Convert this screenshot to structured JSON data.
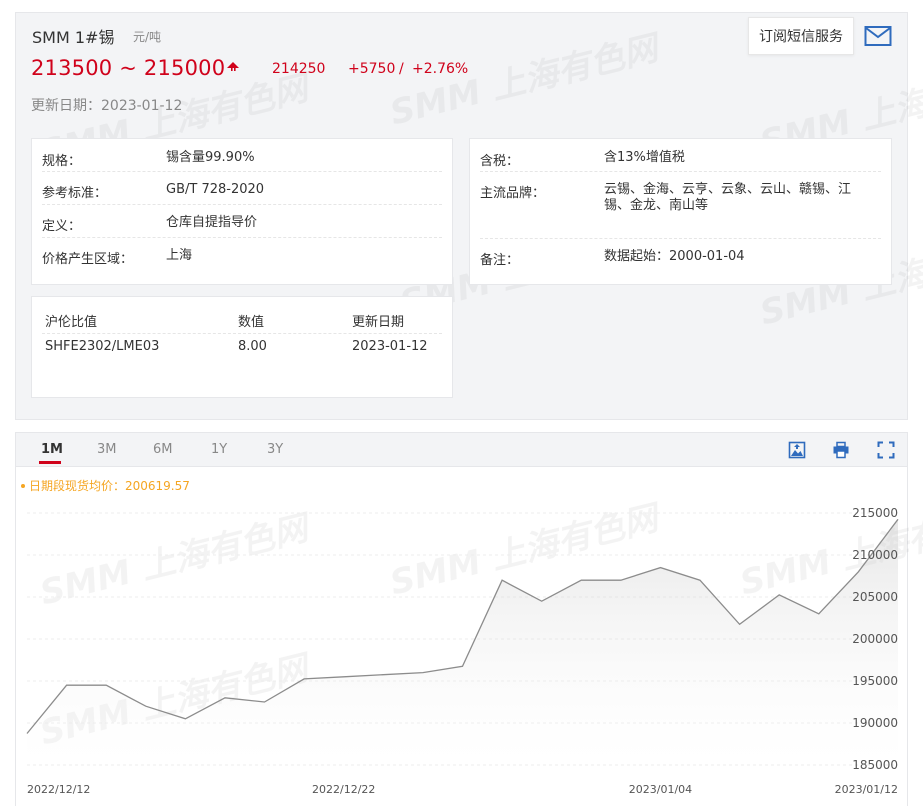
{
  "header": {
    "product_name": "SMM 1#锡",
    "unit": "元/吨",
    "price_range": "213500 ~ 215000",
    "avg_price": "214250",
    "change_value": "+5750",
    "change_separator": "/",
    "change_pct": "+2.76%",
    "update_date": "更新日期：2023-01-12",
    "subscribe_label": "订阅短信服务",
    "trend": "up"
  },
  "spec_left": [
    {
      "label": "规格：",
      "value": "锡含量99.90%"
    },
    {
      "label": "参考标准：",
      "value": "GB/T 728-2020"
    },
    {
      "label": "定义：",
      "value": "仓库自提指导价"
    },
    {
      "label": "价格产生区域：",
      "value": "上海"
    }
  ],
  "spec_right": [
    {
      "label": "含税：",
      "value": "含13%增值税"
    },
    {
      "label": "主流品牌：",
      "value_line1": "云锡、金海、云亨、云象、云山、赣锡、江",
      "value_line2": "锡、金龙、南山等"
    },
    {
      "label": "备注：",
      "value": "数据起始：2000-01-04"
    }
  ],
  "ratio_table": {
    "headers": [
      "沪伦比值",
      "数值",
      "更新日期"
    ],
    "row": [
      "SHFE2302/LME03",
      "8.00",
      "2023-01-12"
    ]
  },
  "chart_panel": {
    "tabs": [
      "1M",
      "3M",
      "6M",
      "1Y",
      "3Y"
    ],
    "active_tab": "1M",
    "icons": [
      "download-image-icon",
      "print-icon",
      "fullscreen-icon"
    ],
    "watermark_text": "SMM 上海有色网"
  },
  "chart_data": {
    "type": "area",
    "legend_text": "日期段现货均价：200619.57",
    "x": [
      "2022/12/12",
      "2022/12/13",
      "2022/12/14",
      "2022/12/15",
      "2022/12/16",
      "2022/12/19",
      "2022/12/20",
      "2022/12/21",
      "2022/12/22",
      "2022/12/23",
      "2022/12/26",
      "2022/12/27",
      "2022/12/28",
      "2022/12/29",
      "2022/12/30",
      "2023/01/03",
      "2023/01/04",
      "2023/01/05",
      "2023/01/06",
      "2023/01/09",
      "2023/01/10",
      "2023/01/11",
      "2023/01/12"
    ],
    "values": [
      188750,
      194500,
      194500,
      192000,
      190500,
      193000,
      192500,
      195250,
      195500,
      195750,
      196000,
      196750,
      207000,
      204500,
      207000,
      207000,
      208500,
      207000,
      201750,
      205250,
      203000,
      208000,
      214250
    ],
    "x_tick_labels": [
      "2022/12/12",
      "2022/12/22",
      "2023/01/04",
      "2023/01/12"
    ],
    "y_ticks": [
      185000,
      190000,
      195000,
      200000,
      205000,
      210000,
      215000
    ],
    "ylim": [
      185000,
      215000
    ],
    "grid": true,
    "line_color": "#8c8c8c",
    "legend_color": "#f5a623",
    "price_color": "#d0021b"
  }
}
